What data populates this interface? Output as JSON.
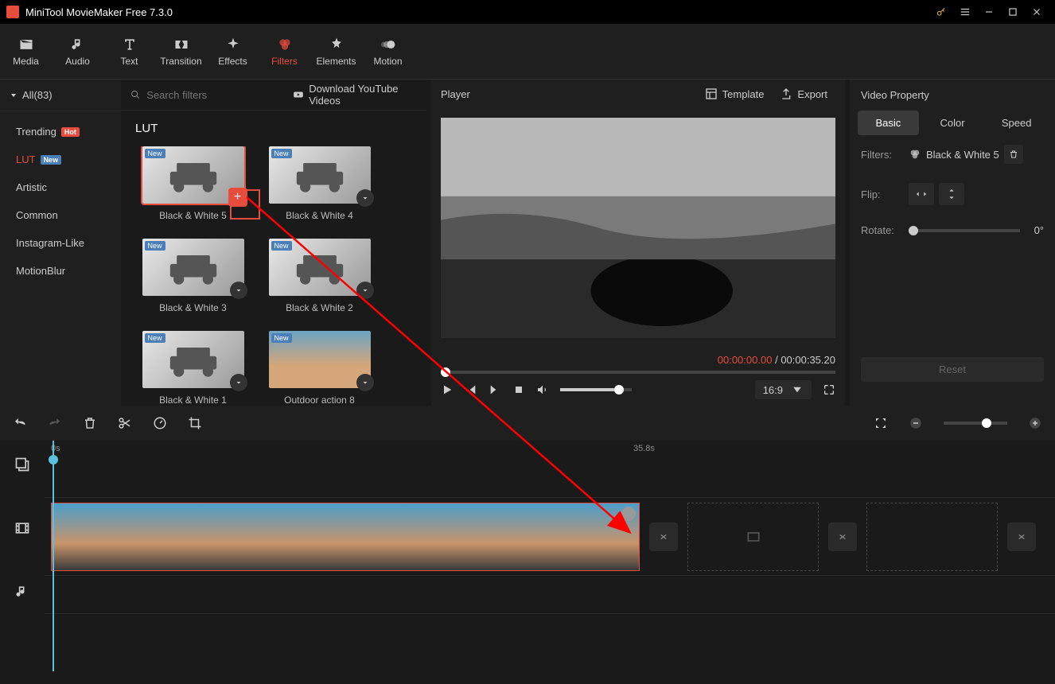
{
  "app_title": "MiniTool MovieMaker Free 7.3.0",
  "toolbar": {
    "tabs": [
      "Media",
      "Audio",
      "Text",
      "Transition",
      "Effects",
      "Filters",
      "Elements",
      "Motion"
    ],
    "active": "Filters"
  },
  "categories": {
    "header_all": "All(83)",
    "items": [
      {
        "label": "Trending",
        "badge": "Hot"
      },
      {
        "label": "LUT",
        "badge": "New",
        "active": true
      },
      {
        "label": "Artistic"
      },
      {
        "label": "Common"
      },
      {
        "label": "Instagram-Like"
      },
      {
        "label": "MotionBlur"
      }
    ]
  },
  "filter_area": {
    "search_placeholder": "Search filters",
    "yt_link": "Download YouTube Videos",
    "section_title": "LUT",
    "thumbs": [
      {
        "label": "Black & White 5",
        "new": true,
        "selected": true,
        "add": true
      },
      {
        "label": "Black & White 4",
        "new": true
      },
      {
        "label": "Black & White 3",
        "new": true
      },
      {
        "label": "Black & White 2",
        "new": true
      },
      {
        "label": "Black & White 1",
        "new": true
      },
      {
        "label": "Outdoor action 8",
        "new": true
      }
    ]
  },
  "player": {
    "title": "Player",
    "template": "Template",
    "export": "Export",
    "time_current": "00:00:00.00",
    "time_total": "00:00:35.20",
    "ratio": "16:9"
  },
  "props": {
    "title": "Video Property",
    "tabs": [
      "Basic",
      "Color",
      "Speed"
    ],
    "active": "Basic",
    "filters_label": "Filters:",
    "filters_value": "Black & White 5",
    "flip_label": "Flip:",
    "rotate_label": "Rotate:",
    "rotate_value": "0°",
    "reset": "Reset"
  },
  "timeline": {
    "ruler": [
      "0s",
      "35.8s"
    ]
  }
}
